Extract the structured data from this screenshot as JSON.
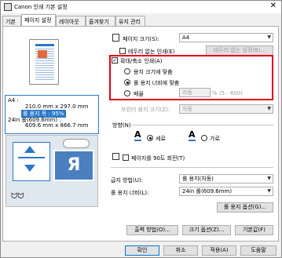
{
  "window": {
    "title": "Canon             인쇄 기본 설정",
    "close": "✕"
  },
  "tabs": [
    "기본",
    "페이지 설정",
    "레이아웃",
    "즐겨찾기",
    "유지 관리"
  ],
  "preview": {
    "info": [
      "A4 :",
      "210.0 mm x 297.0 mm",
      "롤 용지 폭 : 95%",
      "24in 롤(609.6mm) :",
      "609.6 mm x 866.7 mm"
    ]
  },
  "page_size": {
    "label": "페이지 크기(S):",
    "value": "A4"
  },
  "borderless": {
    "label": "테두리 없는 인쇄(E)",
    "settings_button": "테두리 없는 설정(B)..."
  },
  "scaled": {
    "label": "확대/축소 인쇄(A)",
    "fit_paper": "용지 크기에 맞춤",
    "fit_roll": "롤 용지 너비에 맞춤",
    "scaling": "배율",
    "scaling_value": "자동",
    "scaling_unit": "% (5 - 600)"
  },
  "printer_paper": {
    "label": "프린터 용지 크기(Z):",
    "value": "자동"
  },
  "orientation": {
    "label": "방향(N)",
    "portrait": "세로",
    "landscape": "가로",
    "glyph": "A"
  },
  "rotate": {
    "label": "페이지를 90도 회전(T)"
  },
  "feed": {
    "label": "급지 방법(U):",
    "value": "롤 용지(자동)"
  },
  "roll_width": {
    "label": "롤 용지 너비(L):",
    "value": "24in 롤(609.6mm)"
  },
  "roll_options_button": "롤 용지 옵션(G)...",
  "bottom_buttons": [
    "출력 방법(O)...",
    "크기 옵션(Z)...",
    "기본값(F)"
  ],
  "dialog_buttons": [
    "확인",
    "취소",
    "적용(A)",
    "도움말"
  ],
  "colors": {
    "highlight": "#e0001a",
    "preview_blue": "#2a78c8"
  }
}
